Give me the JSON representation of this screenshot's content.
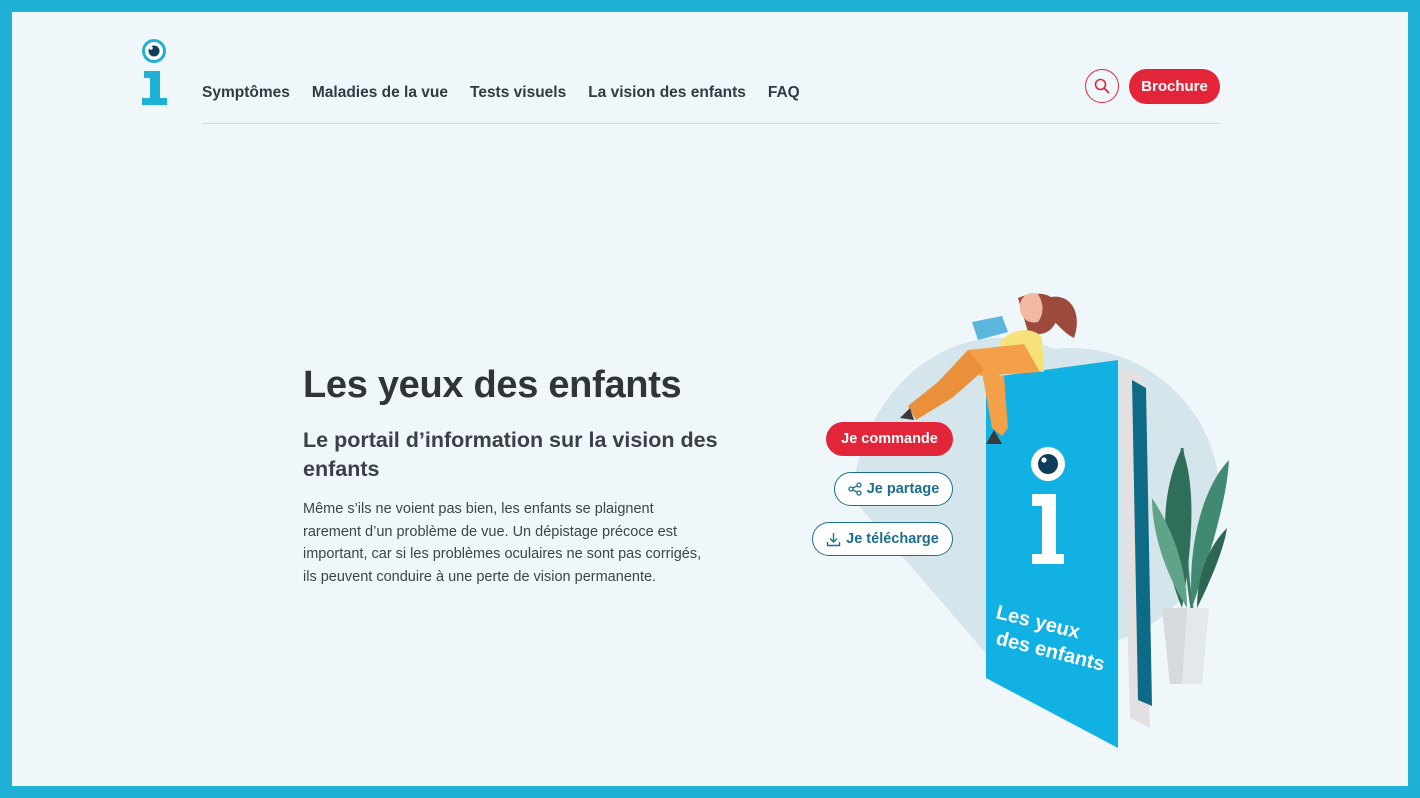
{
  "header": {
    "logo": {
      "icon": "info-eye-logo-icon",
      "colors": {
        "blue": "#1fb0d6",
        "pupil": "#0f3d5c"
      }
    },
    "nav": [
      {
        "label": "Symptômes"
      },
      {
        "label": "Maladies de la vue"
      },
      {
        "label": "Tests visuels"
      },
      {
        "label": "La vision des enfants"
      },
      {
        "label": "FAQ"
      }
    ],
    "search": {
      "icon": "search-icon"
    },
    "brochure_button": "Brochure"
  },
  "hero": {
    "title": "Les yeux des enfants",
    "subtitle": "Le portail d’information sur la vision des enfants",
    "body": "Même s’ils ne voient pas bien, les enfants se plaignent rarement d’un problème de vue. Un dépistage précoce est important, car si les problèmes oculaires ne sont pas corrigés, ils peuvent conduire à une perte de vision permanente."
  },
  "actions": {
    "order": "Je commande",
    "share": {
      "label": "Je partage",
      "icon": "share-icon"
    },
    "download": {
      "label": "Je télécharge",
      "icon": "download-icon"
    }
  },
  "illustration": {
    "book_cover_line1": "Les yeux",
    "book_cover_line2": "des enfants"
  },
  "colors": {
    "accent_red": "#e3253a",
    "frame_blue": "#1fb0d6",
    "background": "#eff7fa",
    "text_dark": "#2f3438",
    "outline_teal": "#1b6f8c"
  }
}
